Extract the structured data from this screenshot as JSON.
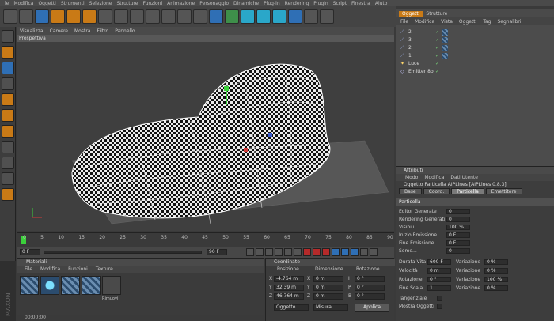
{
  "menubar": [
    "le",
    "Modifica",
    "Oggetti",
    "Strumenti",
    "Selezione",
    "Strutture",
    "Funzioni",
    "Animazione",
    "Personaggio",
    "Dinamiche",
    "Plug-in",
    "Rendering",
    "Plugin",
    "Script",
    "Finestra",
    "Aiuto"
  ],
  "viewport": {
    "menu": [
      "Visualizza",
      "Camere",
      "Mostra",
      "Filtro",
      "Pannello"
    ],
    "title": "Prospettiva"
  },
  "timeline": {
    "ticks": [
      "0",
      "5",
      "10",
      "15",
      "20",
      "25",
      "30",
      "35",
      "40",
      "45",
      "50",
      "55",
      "60",
      "65",
      "70",
      "75",
      "80",
      "85",
      "90"
    ],
    "start_frame": "0 F",
    "end_frame": "90 F",
    "current_frame": "0 F"
  },
  "materials": {
    "header": "Materiali",
    "menu": [
      "File",
      "Modifica",
      "Funzioni",
      "Texture"
    ],
    "items": [
      "",
      "",
      "",
      "",
      "Rimuovi"
    ]
  },
  "coords": {
    "header": "Coordinate",
    "col_headers": [
      "Posizione",
      "Dimensione",
      "Rotazione"
    ],
    "rows": [
      {
        "axis": "X",
        "pos": "-4.764 m",
        "dim": "0 m",
        "rot": "H",
        "rot_val": "0 °"
      },
      {
        "axis": "Y",
        "pos": "32.39 m",
        "dim": "0 m",
        "rot": "P",
        "rot_val": "0 °"
      },
      {
        "axis": "Z",
        "pos": "46.764 m",
        "dim": "0 m",
        "rot": "B",
        "rot_val": "0 °"
      }
    ],
    "mode_left": "Oggetto",
    "mode_mid": "Misura",
    "apply": "Applica"
  },
  "objects": {
    "tabs": [
      "Oggetti",
      "Strutture"
    ],
    "menu": [
      "File",
      "Modifica",
      "Vista",
      "Oggetti",
      "Tag",
      "Segnalibri"
    ],
    "items": [
      "2",
      "3",
      "2",
      "1",
      "Luce",
      "Emitter 8b"
    ]
  },
  "attributes": {
    "header": "Attributi",
    "menu": [
      "Modo",
      "Modifica",
      "Dati Utente"
    ],
    "object_line": "Oggetto Particella AIPLines [AIPLines 0.8.3]",
    "tabs": [
      "Base",
      "Coord.",
      "Particella",
      "Emettitore"
    ],
    "section": "Particella",
    "fields": [
      {
        "label": "Editor Generate",
        "value": "0"
      },
      {
        "label": "Rendering Generati",
        "value": "0"
      },
      {
        "label": "Visibili...",
        "value": "100 %"
      },
      {
        "label": "Inizio Emissione",
        "value": "0 F"
      },
      {
        "label": "Fine Emissione",
        "value": "0 F"
      },
      {
        "label": "Seme...",
        "value": "0"
      }
    ],
    "pairs": [
      {
        "label": "Durata Vita",
        "value": "600 F",
        "var_label": "Variazione",
        "var_value": "0 %"
      },
      {
        "label": "Velocità",
        "value": "0 m",
        "var_label": "Variazione",
        "var_value": "0 %"
      },
      {
        "label": "Rotazione",
        "value": "0 °",
        "var_label": "Variazione",
        "var_value": "100 %"
      },
      {
        "label": "Fine Scala",
        "value": "1",
        "var_label": "Variazione",
        "var_value": "0 %"
      }
    ],
    "checks": [
      "Tangenziale",
      "Mostra Oggetti"
    ]
  },
  "status": "00:00:00",
  "colors": {
    "accent": "#c97a16",
    "blue": "#2f6fb5",
    "cyan": "#2aa7c9",
    "panel": "#3b3b3b"
  }
}
